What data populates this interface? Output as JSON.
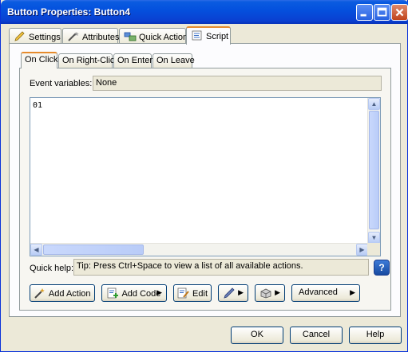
{
  "window": {
    "title": "Button Properties: Button4"
  },
  "tabs": [
    {
      "label": "Settings",
      "icon": "pencil-icon"
    },
    {
      "label": "Attributes",
      "icon": "wand-icon"
    },
    {
      "label": "Quick Action",
      "icon": "quick-action-icon"
    },
    {
      "label": "Script",
      "icon": "script-icon",
      "active": true
    }
  ],
  "subtabs": [
    {
      "label": "On Click",
      "active": true
    },
    {
      "label": "On Right-Click"
    },
    {
      "label": "On Enter"
    },
    {
      "label": "On Leave"
    }
  ],
  "event_vars": {
    "label": "Event variables:",
    "value": "None"
  },
  "editor": {
    "line1": "01"
  },
  "quick_help": {
    "label": "Quick help:",
    "tip": "Tip: Press Ctrl+Space to view a list of all available actions."
  },
  "toolbar": {
    "add_action": "Add Action",
    "add_code": "Add Code",
    "edit": "Edit",
    "advanced": "Advanced"
  },
  "dialog_buttons": {
    "ok": "OK",
    "cancel": "Cancel",
    "help": "Help"
  }
}
